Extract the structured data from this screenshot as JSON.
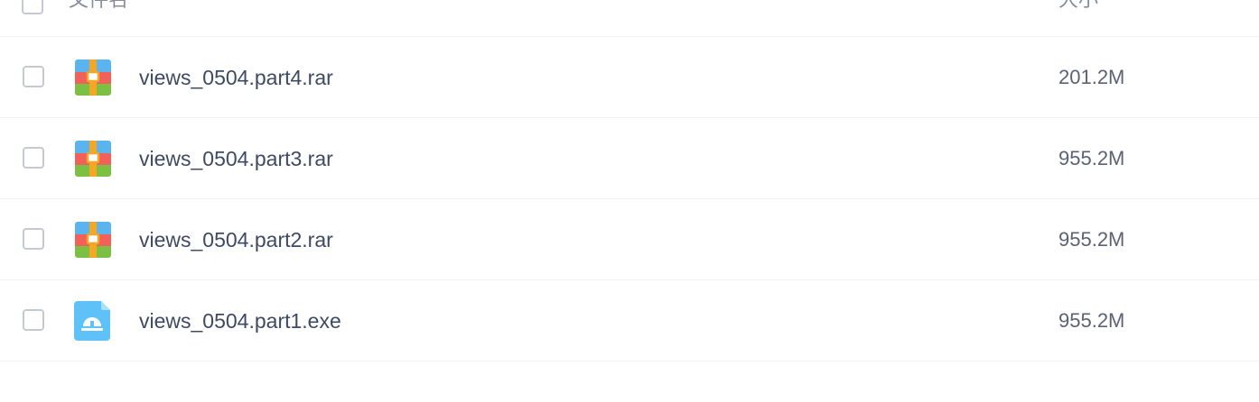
{
  "header": {
    "name_label": "文件名",
    "size_label": "大小"
  },
  "files": [
    {
      "name": "views_0504.part4.rar",
      "size": "201.2M",
      "icon": "rar-archive-icon"
    },
    {
      "name": "views_0504.part3.rar",
      "size": "955.2M",
      "icon": "rar-archive-icon"
    },
    {
      "name": "views_0504.part2.rar",
      "size": "955.2M",
      "icon": "rar-archive-icon"
    },
    {
      "name": "views_0504.part1.exe",
      "size": "955.2M",
      "icon": "exe-file-icon"
    }
  ],
  "colors": {
    "archive_blue": "#5ab4ef",
    "archive_red": "#f2605a",
    "archive_green": "#7bc043",
    "archive_strap": "#f5a623",
    "exe_blue": "#5ec1f7"
  }
}
